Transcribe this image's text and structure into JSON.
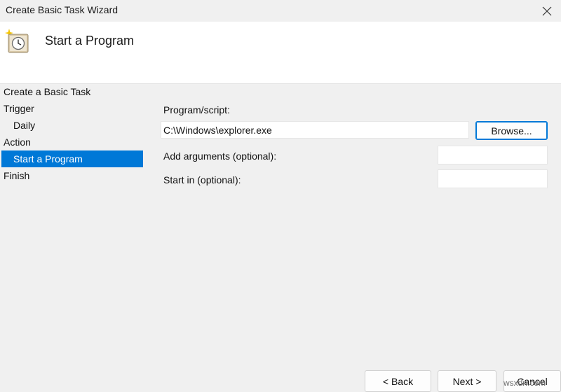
{
  "window": {
    "title": "Create Basic Task Wizard"
  },
  "header": {
    "title": "Start a Program",
    "icon": "task-scheduler-clock-icon"
  },
  "nav": {
    "items": [
      {
        "label": "Create a Basic Task"
      },
      {
        "label": "Trigger"
      },
      {
        "label": "Daily"
      },
      {
        "label": "Action"
      },
      {
        "label": "Start a Program"
      },
      {
        "label": "Finish"
      }
    ]
  },
  "form": {
    "program_label": "Program/script:",
    "program_value": "C:\\Windows\\explorer.exe",
    "browse_label": "Browse...",
    "arguments_label": "Add arguments (optional):",
    "arguments_value": "",
    "start_in_label": "Start in (optional):",
    "start_in_value": ""
  },
  "footer": {
    "back_label": "< Back",
    "next_label": "Next >",
    "cancel_label": "Cancel"
  },
  "watermark": "wsxdn.com",
  "colors": {
    "selection": "#0078d7",
    "header_bg": "#ffffff",
    "body_bg": "#f0f0f0"
  }
}
